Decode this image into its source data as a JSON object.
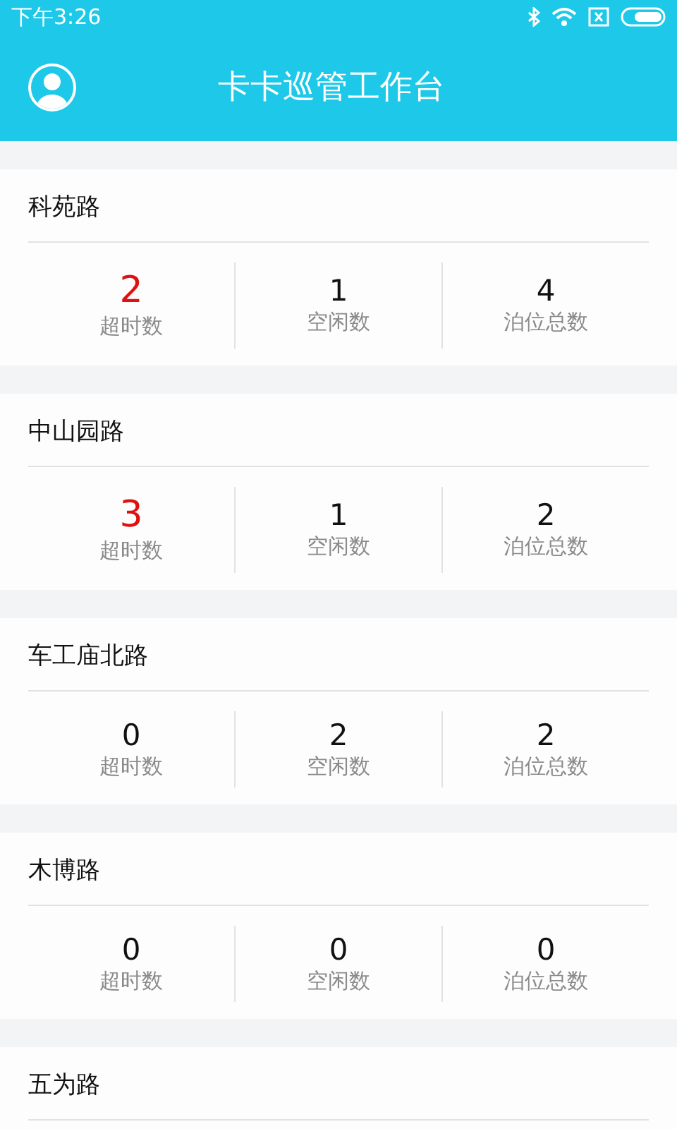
{
  "status_bar": {
    "time": "下午3:26"
  },
  "header": {
    "title": "卡卡巡管工作台"
  },
  "roads": [
    {
      "name": "科苑路",
      "stats": [
        {
          "value": "2",
          "label": "超时数",
          "alert": true
        },
        {
          "value": "1",
          "label": "空闲数",
          "alert": false
        },
        {
          "value": "4",
          "label": "泊位总数",
          "alert": false
        }
      ]
    },
    {
      "name": "中山园路",
      "stats": [
        {
          "value": "3",
          "label": "超时数",
          "alert": true
        },
        {
          "value": "1",
          "label": "空闲数",
          "alert": false
        },
        {
          "value": "2",
          "label": "泊位总数",
          "alert": false
        }
      ]
    },
    {
      "name": "车工庙北路",
      "stats": [
        {
          "value": "0",
          "label": "超时数",
          "alert": false
        },
        {
          "value": "2",
          "label": "空闲数",
          "alert": false
        },
        {
          "value": "2",
          "label": "泊位总数",
          "alert": false
        }
      ]
    },
    {
      "name": "木博路",
      "stats": [
        {
          "value": "0",
          "label": "超时数",
          "alert": false
        },
        {
          "value": "0",
          "label": "空闲数",
          "alert": false
        },
        {
          "value": "0",
          "label": "泊位总数",
          "alert": false
        }
      ]
    },
    {
      "name": "五为路"
    }
  ]
}
